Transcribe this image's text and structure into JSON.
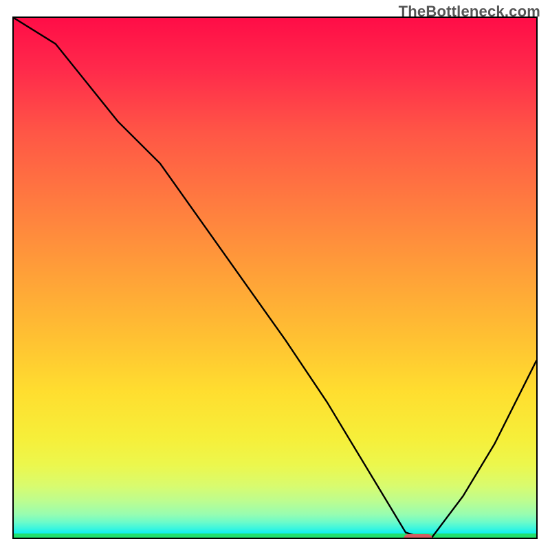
{
  "watermark": "TheBottleneck.com",
  "colors": {
    "curve": "#000000",
    "marker": "#d65a62",
    "green_band": "#21e06d",
    "border": "#000000"
  },
  "chart_data": {
    "type": "line",
    "title": "",
    "xlabel": "",
    "ylabel": "",
    "xlim": [
      0,
      100
    ],
    "ylim": [
      0,
      100
    ],
    "grid": false,
    "legend": false,
    "series": [
      {
        "name": "bottleneck-curve",
        "x": [
          0,
          8,
          20,
          28,
          40,
          52,
          60,
          66,
          72,
          75,
          78,
          80,
          86,
          92,
          100
        ],
        "y": [
          100,
          95,
          80,
          72,
          55,
          38,
          26,
          16,
          6,
          1,
          0,
          0,
          8,
          18,
          34
        ]
      }
    ],
    "marker": {
      "x": 77,
      "y": 0.2
    },
    "green_band_y": [
      0,
      1.3
    ]
  }
}
